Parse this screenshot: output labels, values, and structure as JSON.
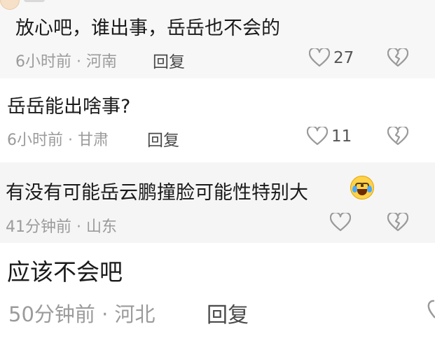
{
  "comments": [
    {
      "text": "放心吧，谁出事，岳岳也不会的",
      "meta": "6小时前 · 河南",
      "reply": "回复",
      "likes": "27"
    },
    {
      "text": "岳岳能出啥事?",
      "meta": "6小时前 · 甘肃",
      "reply": "回复",
      "likes": "11"
    },
    {
      "text": "有没有可能岳云鹏撞脸可能性特别大",
      "meta": "41分钟前 · 山东",
      "reply": "",
      "likes": ""
    },
    {
      "text": "应该不会吧",
      "meta": "50分钟前 · 河北",
      "reply": "回复",
      "likes": ""
    }
  ],
  "icons": {
    "like": "heart-outline-icon",
    "dislike": "broken-heart-icon",
    "emoji": "tears-of-joy-emoji"
  },
  "colors": {
    "meta_text": "#9b9b9b",
    "comment_text": "#1a1a1a",
    "icon_stroke": "#9a9a9a"
  }
}
